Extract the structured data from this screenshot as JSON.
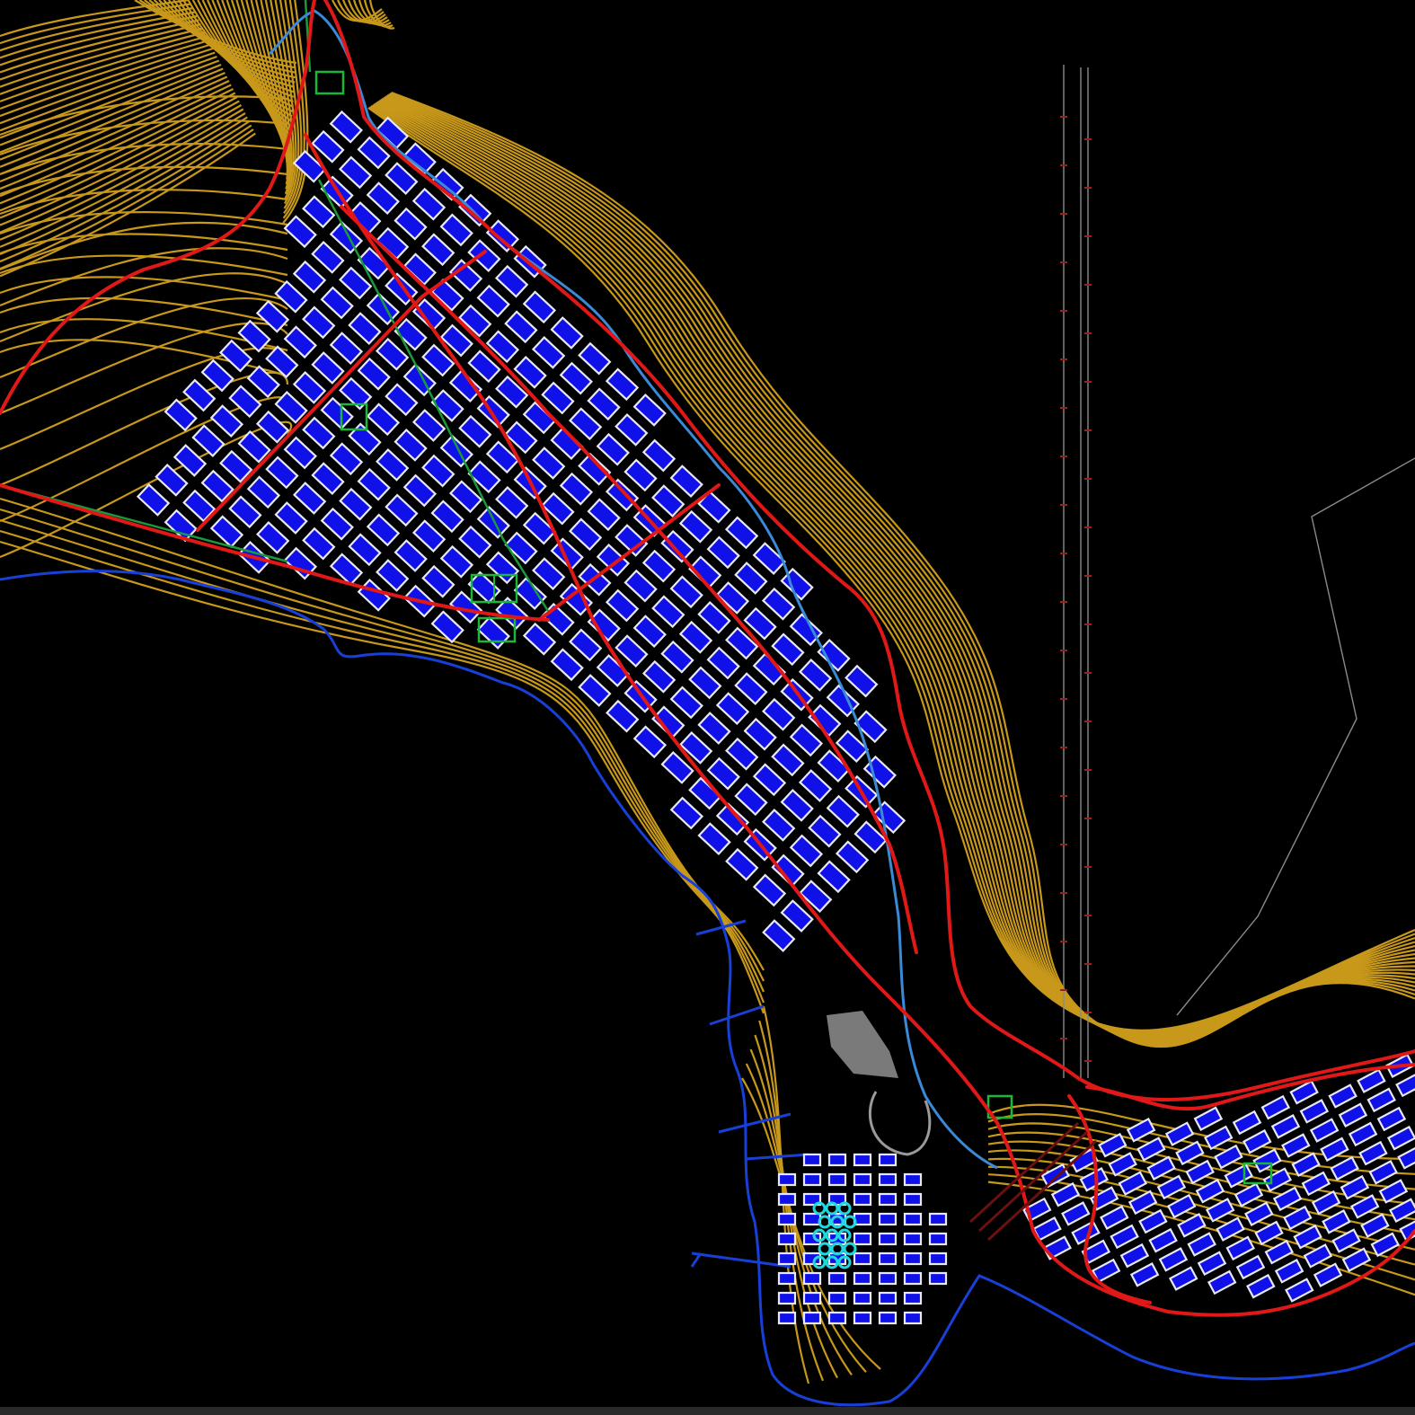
{
  "viewport": {
    "background": "#000000",
    "layers": [
      {
        "name": "contours",
        "color": "#c8981a"
      },
      {
        "name": "main-roads",
        "color": "#e01818"
      },
      {
        "name": "city-blocks-fill",
        "color": "#1010e8"
      },
      {
        "name": "street-outlines",
        "color": "#e8e8f4"
      },
      {
        "name": "railway",
        "color": "#1a9a3a"
      },
      {
        "name": "river",
        "color": "#3a8ad8"
      },
      {
        "name": "coastline",
        "color": "#1840d8"
      },
      {
        "name": "sports-fields",
        "color": "#18b838"
      },
      {
        "name": "storage-tanks",
        "color": "#20d8e0"
      },
      {
        "name": "guide-lines",
        "color": "#8a8a8a"
      },
      {
        "name": "port-area",
        "color": "#9a9a9a"
      }
    ]
  }
}
